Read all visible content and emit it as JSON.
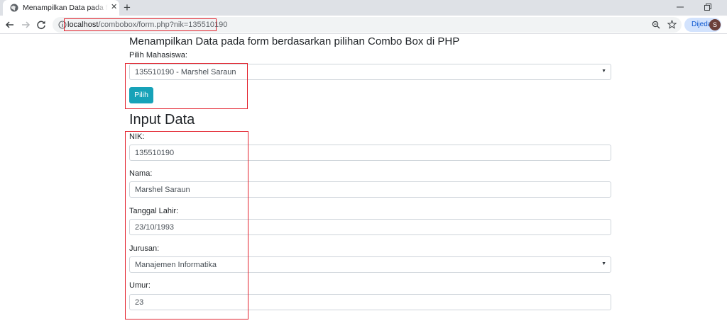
{
  "browser": {
    "tab_title": "Menampilkan Data pada form berdasarkan pilihan Combo Box di PHP",
    "url_host": "localhost",
    "url_path": "/combobox/form.php?nik=135510190",
    "profile_label": "Dijeda",
    "profile_initial": "S"
  },
  "icons": {
    "tab": "globe-icon",
    "close": "close-icon",
    "new_tab": "plus-icon",
    "back": "back-arrow-icon",
    "forward": "forward-arrow-icon",
    "reload": "reload-icon",
    "info": "info-icon",
    "zoom": "zoom-icon",
    "bookmark": "star-icon",
    "select_caret": "caret-down-icon"
  },
  "page": {
    "heading": "Menampilkan Data pada form berdasarkan pilihan Combo Box di PHP",
    "select_label": "Pilih Mahasiswa:",
    "selected_student": "135510190 - Marshel Saraun",
    "pilih_button": "Pilih",
    "input_title": "Input Data",
    "fields": {
      "nik": {
        "label": "NIK:",
        "value": "135510190"
      },
      "nama": {
        "label": "Nama:",
        "value": "Marshel Saraun"
      },
      "tanggal_lahir": {
        "label": "Tanggal Lahir:",
        "value": "23/10/1993"
      },
      "jurusan": {
        "label": "Jurusan:",
        "value": "Manajemen Informatika"
      },
      "umur": {
        "label": "Umur:",
        "value": "23"
      }
    }
  },
  "colors": {
    "highlight": "#e3232e",
    "button": "#17a2b8",
    "tabstrip": "#dee1e6",
    "omnibox": "#f1f3f4",
    "profile_chip": "#d3e3fd"
  }
}
